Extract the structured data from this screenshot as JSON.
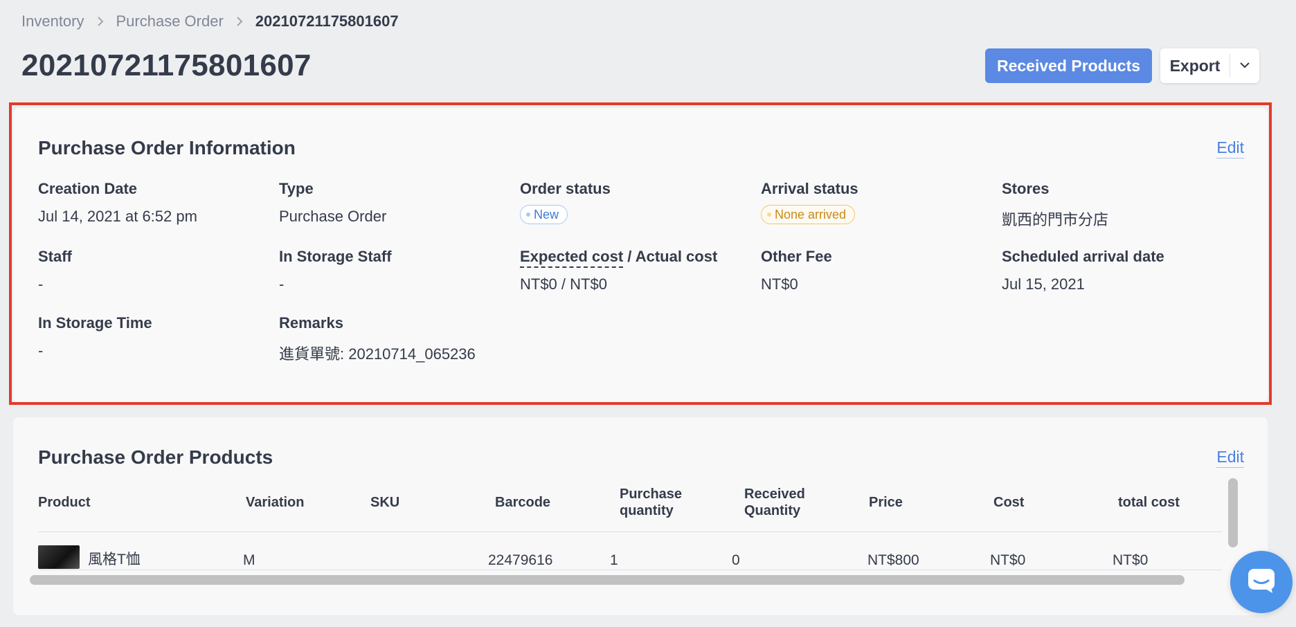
{
  "breadcrumb": {
    "items": [
      "Inventory",
      "Purchase Order",
      "20210721175801607"
    ]
  },
  "page": {
    "title": "20210721175801607"
  },
  "actions": {
    "received_products": "Received Products",
    "export": "Export"
  },
  "info_card": {
    "title": "Purchase Order Information",
    "edit": "Edit",
    "fields": {
      "creation_date": {
        "label": "Creation Date",
        "value": "Jul 14, 2021 at 6:52 pm"
      },
      "type": {
        "label": "Type",
        "value": "Purchase Order"
      },
      "order_status": {
        "label": "Order status",
        "value": "New"
      },
      "arrival_status": {
        "label": "Arrival status",
        "value": "None arrived"
      },
      "stores": {
        "label": "Stores",
        "value": "凱西的門市分店"
      },
      "staff": {
        "label": "Staff",
        "value": "-"
      },
      "in_storage_staff": {
        "label": "In Storage Staff",
        "value": "-"
      },
      "cost": {
        "label_part1": "Expected cost",
        "label_part2": " / Actual cost",
        "value": "NT$0 / NT$0"
      },
      "other_fee": {
        "label": "Other Fee",
        "value": "NT$0"
      },
      "scheduled_arrival": {
        "label": "Scheduled arrival date",
        "value": "Jul 15, 2021"
      },
      "in_storage_time": {
        "label": "In Storage Time",
        "value": "-"
      },
      "remarks": {
        "label": "Remarks",
        "value": "進貨單號: 20210714_065236"
      }
    }
  },
  "products_card": {
    "title": "Purchase Order Products",
    "edit": "Edit",
    "columns": {
      "product": "Product",
      "variation": "Variation",
      "sku": "SKU",
      "barcode": "Barcode",
      "purchase_qty_1": "Purchase",
      "purchase_qty_2": "quantity",
      "received_qty_1": "Received",
      "received_qty_2": "Quantity",
      "price": "Price",
      "cost": "Cost",
      "total_cost": "total cost"
    },
    "rows": [
      {
        "product": "風格T恤",
        "variation": "M",
        "sku": "",
        "barcode": "22479616",
        "purchase_quantity": "1",
        "received_quantity": "0",
        "price": "NT$800",
        "cost": "NT$0",
        "total_cost": "NT$0"
      }
    ]
  },
  "colors": {
    "primary": "#5b89e3",
    "highlight": "#e23b2b",
    "link": "#4a7fe0",
    "chat": "#4b94ea"
  }
}
